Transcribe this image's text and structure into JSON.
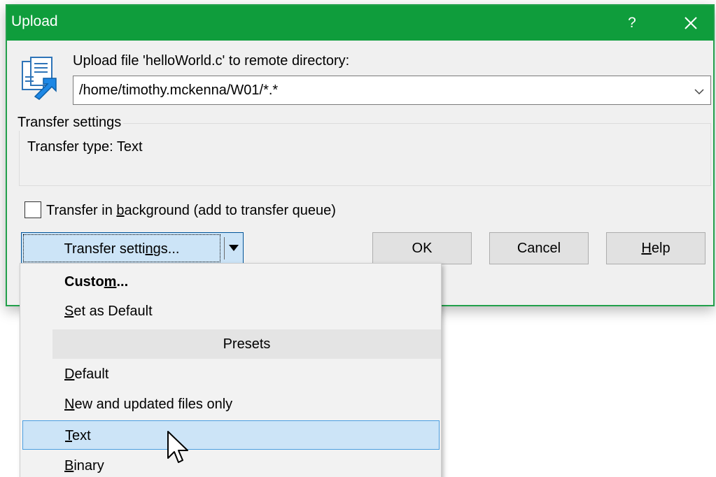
{
  "dialog": {
    "title": "Upload",
    "help_label": "?",
    "prompt": "Upload file 'helloWorld.c' to remote directory:",
    "remote_path": "/home/timothy.mckenna/W01/*.*",
    "settings_group_title": "Transfer settings",
    "transfer_type_text": "Transfer type: Text",
    "background_checkbox": {
      "label_before": "Transfer in ",
      "label_accel": "b",
      "label_after": "ackground (add to transfer queue)",
      "checked": false
    },
    "buttons": {
      "transfer_settings_before": "Transfer setti",
      "transfer_settings_accel": "n",
      "transfer_settings_after": "gs...",
      "ok": "OK",
      "cancel": "Cancel",
      "help_accel": "H",
      "help_rest": "elp"
    }
  },
  "menu": {
    "custom": {
      "before": "Custo",
      "accel": "m",
      "after": "..."
    },
    "set_default": {
      "accel": "S",
      "rest": "et as Default"
    },
    "presets_header": "Presets",
    "default": {
      "accel": "D",
      "rest": "efault"
    },
    "new_updated": {
      "accel": "N",
      "rest": "ew and updated files only"
    },
    "text": {
      "accel": "T",
      "rest": "ext"
    },
    "binary": {
      "accel": "B",
      "rest": "inary"
    },
    "highlighted": "Text"
  },
  "icons": [
    "upload-file-icon",
    "close-icon",
    "chevron-down-icon",
    "dropdown-arrow-icon",
    "mouse-cursor-icon"
  ],
  "colors": {
    "titlebar": "#0f9d3c",
    "dialog_bg": "#f0f0f0",
    "highlight": "#cce4f7",
    "highlight_border": "#4a9ee0"
  }
}
